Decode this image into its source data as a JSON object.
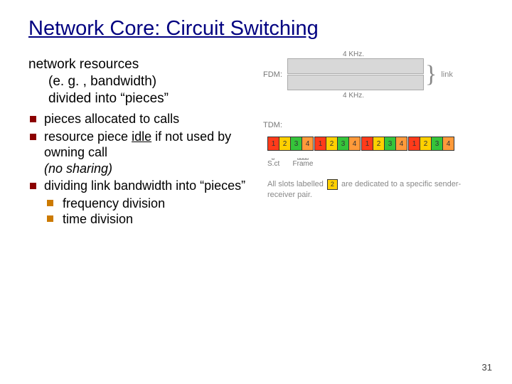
{
  "title": "Network Core: Circuit Switching",
  "intro": {
    "line1": "network resources",
    "line2": "(e. g. , bandwidth)",
    "line3": "divided into “pieces”"
  },
  "bullets": {
    "b1": "pieces allocated to calls",
    "b2a": "resource piece ",
    "b2idle": "idle",
    "b2b": " if not used by owning call ",
    "b2c": "(no sharing)",
    "b3": "dividing link bandwidth into “pieces”",
    "s1": "frequency division",
    "s2": "time division"
  },
  "fdm": {
    "label": "FDM:",
    "khz": "4 KHz.",
    "link": "link"
  },
  "tdm": {
    "label": "TDM:",
    "cells": [
      "1",
      "2",
      "3",
      "4"
    ],
    "slot": "S.ct",
    "frame": "Frame",
    "caption1": "All slots labelled ",
    "captionNum": "2",
    "caption2": " are dedicated to a specific sender-receiver pair."
  },
  "pageNum": "31"
}
